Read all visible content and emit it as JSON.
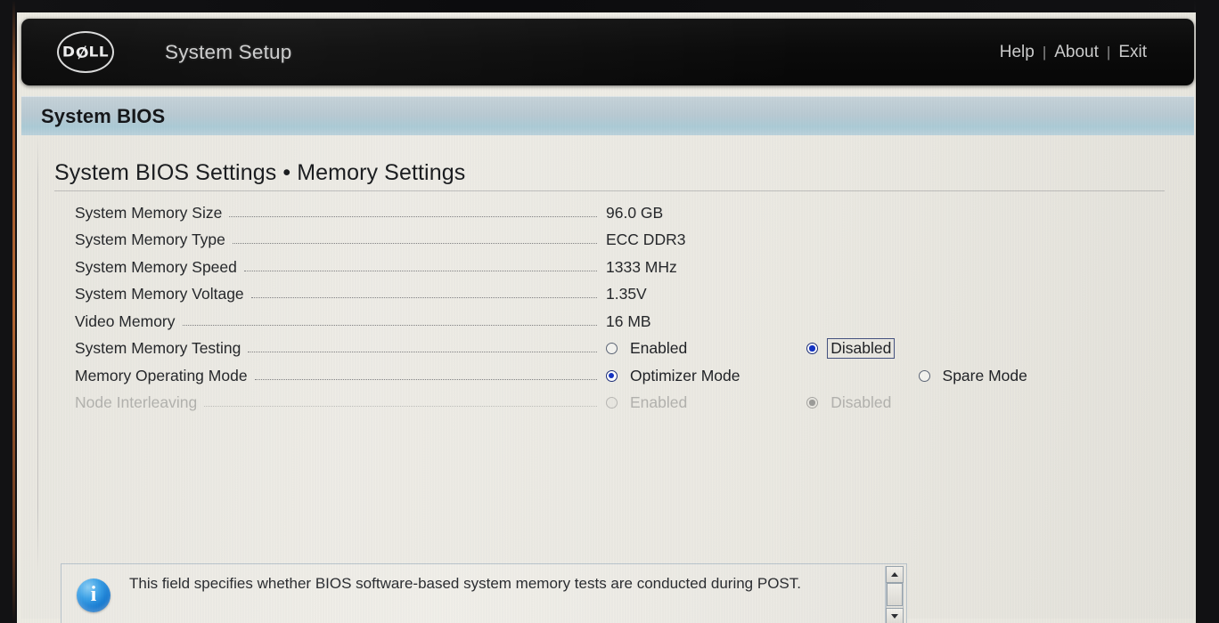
{
  "titlebar": {
    "logo_name": "dell-logo",
    "logo_text_left": "D",
    "logo_text_slash": "Ø",
    "logo_text_right": "LL",
    "app_title": "System Setup",
    "nav": [
      {
        "label": "Help"
      },
      {
        "label": "About"
      },
      {
        "label": "Exit"
      }
    ],
    "nav_separator": "|"
  },
  "section_bar": {
    "title": "System BIOS"
  },
  "page": {
    "title": "System BIOS Settings • Memory Settings"
  },
  "settings": [
    {
      "label": "System Memory Size",
      "type": "text",
      "value": "96.0 GB",
      "disabled": false
    },
    {
      "label": "System Memory Type",
      "type": "text",
      "value": "ECC DDR3",
      "disabled": false
    },
    {
      "label": "System Memory Speed",
      "type": "text",
      "value": "1333 MHz",
      "disabled": false
    },
    {
      "label": "System Memory Voltage",
      "type": "text",
      "value": "1.35V",
      "disabled": false
    },
    {
      "label": "Video Memory",
      "type": "text",
      "value": "16 MB",
      "disabled": false
    },
    {
      "label": "System Memory Testing",
      "type": "radio",
      "disabled": false,
      "options": [
        {
          "label": "Enabled",
          "selected": false,
          "focused": false,
          "offset": 0
        },
        {
          "label": "Disabled",
          "selected": true,
          "focused": true,
          "offset": 130
        }
      ]
    },
    {
      "label": "Memory Operating Mode",
      "type": "radio",
      "disabled": false,
      "options": [
        {
          "label": "Optimizer Mode",
          "selected": true,
          "focused": false,
          "offset": 0
        },
        {
          "label": "Spare Mode",
          "selected": false,
          "focused": false,
          "offset": 196
        }
      ]
    },
    {
      "label": "Node Interleaving",
      "type": "radio",
      "disabled": true,
      "options": [
        {
          "label": "Enabled",
          "selected": false,
          "focused": false,
          "offset": 0
        },
        {
          "label": "Disabled",
          "selected": true,
          "focused": false,
          "offset": 130
        }
      ]
    }
  ],
  "help": {
    "icon": "info-icon",
    "text": "This field specifies whether BIOS software-based system memory tests are conducted during POST.",
    "scrollbar": {
      "up_arrow": "scroll-up-arrow",
      "down_arrow": "scroll-down-arrow"
    }
  },
  "colors": {
    "accent_blue": "#1433c4",
    "section_bar": "#accbd6",
    "info_blue": "#1277d0",
    "titlebar": "#0b0b0b",
    "screen_bg": "#ebe9e2"
  }
}
